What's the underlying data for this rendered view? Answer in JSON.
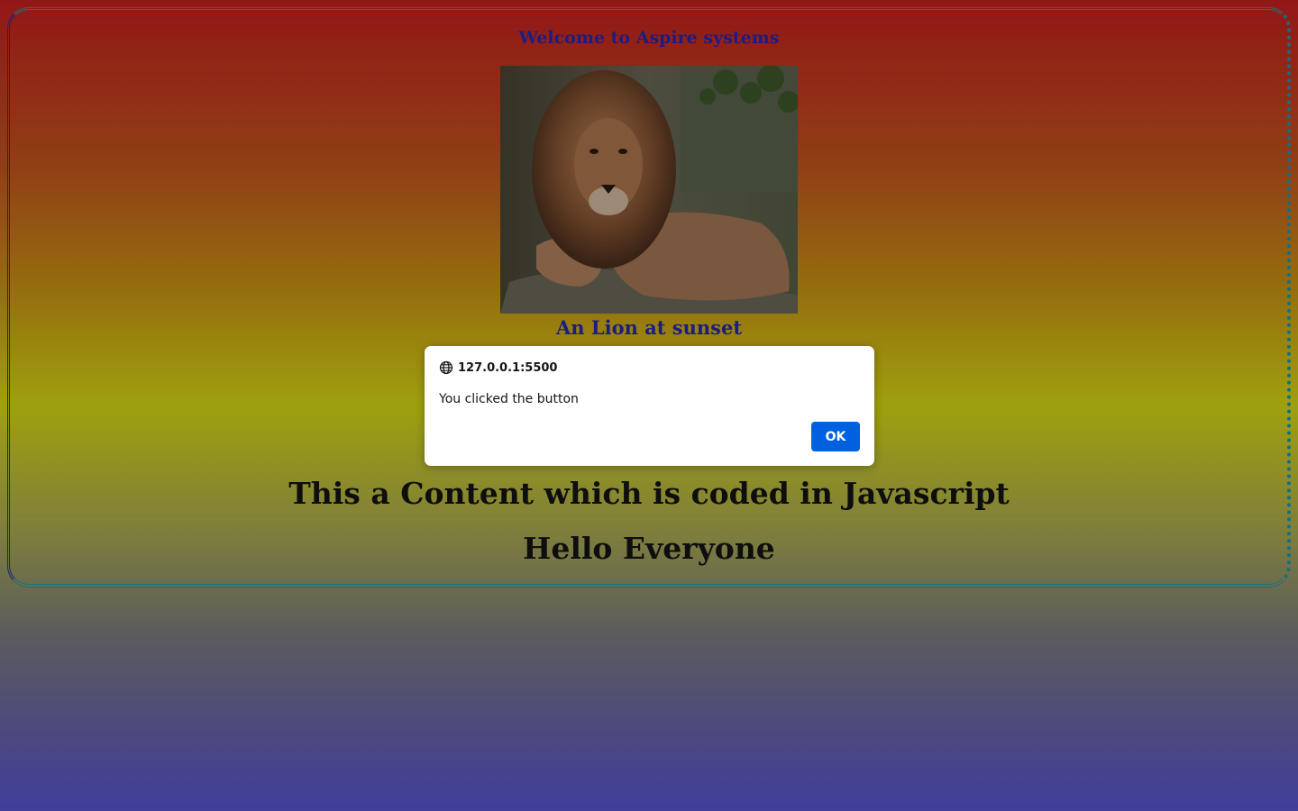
{
  "page": {
    "heading": "Welcome to Aspire systems",
    "image_caption": "An Lion at sunset",
    "content_line_1": "This a Content which is coded in Javascript",
    "content_line_2": "Hello Everyone"
  },
  "dialog": {
    "origin": "127.0.0.1:5500",
    "message": "You clicked the button",
    "ok_label": "OK",
    "icon": "globe-icon"
  },
  "colors": {
    "heading_text": "#2828b4",
    "body_text": "#141414",
    "ok_button": "#0061e0",
    "frame_border": "#2a9aa8"
  }
}
